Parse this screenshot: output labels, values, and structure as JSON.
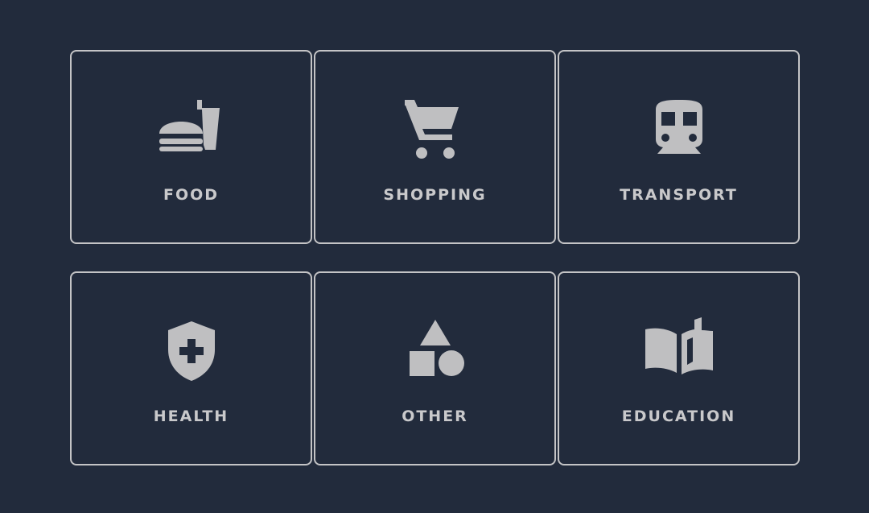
{
  "categories": [
    {
      "label": "FOOD",
      "icon": "fastfood-icon"
    },
    {
      "label": "SHOPPING",
      "icon": "shopping-cart-icon"
    },
    {
      "label": "TRANSPORT",
      "icon": "train-icon"
    },
    {
      "label": "HEALTH",
      "icon": "health-shield-icon"
    },
    {
      "label": "OTHER",
      "icon": "shapes-icon"
    },
    {
      "label": "EDUCATION",
      "icon": "book-icon"
    }
  ],
  "colors": {
    "background": "#222b3c",
    "tile_border": "#c4c4c6",
    "icon": "#bfbfc1",
    "label": "#c9c9cb"
  }
}
